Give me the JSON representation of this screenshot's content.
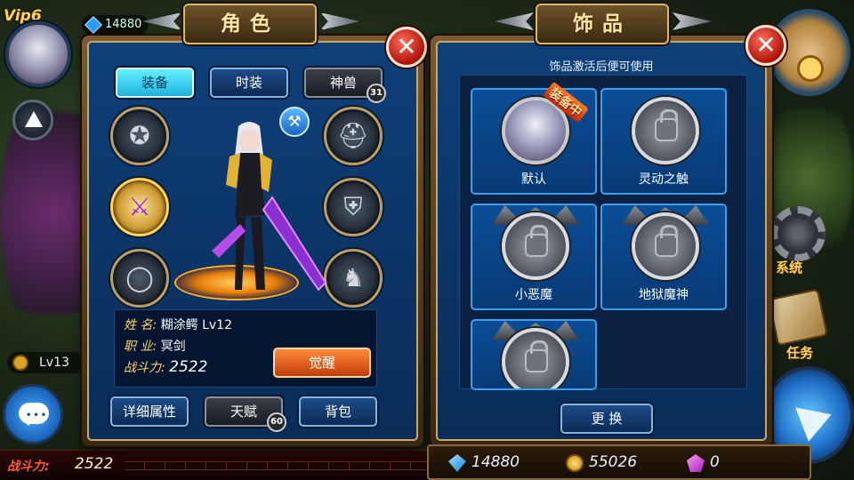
{
  "hud": {
    "vip": "Vip6",
    "top_gems": "14880",
    "level_text": "Lv13",
    "combat_label": "战斗力:",
    "combat_value": "2522",
    "side_system": "系统",
    "side_task": "任务"
  },
  "role_panel": {
    "title": "角色",
    "tabs": [
      {
        "label": "装备",
        "active": true
      },
      {
        "label": "时装",
        "active": false
      },
      {
        "label": "神兽",
        "active": false,
        "lock_level": "31"
      }
    ],
    "equip_slots": [
      {
        "name": "necklace",
        "icon": "pentagram-necklace-icon"
      },
      {
        "name": "helmet",
        "icon": "helmet-icon"
      },
      {
        "name": "weapon",
        "icon": "purple-sword-icon"
      },
      {
        "name": "armor",
        "icon": "armor-icon"
      },
      {
        "name": "ring",
        "icon": "ring-icon"
      },
      {
        "name": "boots",
        "icon": "boots-icon"
      }
    ],
    "info": {
      "name_label": "姓  名:",
      "name_value": "糊涂鳄",
      "level": "Lv12",
      "class_label": "职  业:",
      "class_value": "冥剑",
      "power_label": "战斗力:",
      "power_value": "2522"
    },
    "awaken_button": "觉醒",
    "bottom_buttons": {
      "details": "详细属性",
      "talent": "天赋",
      "talent_lock": "60",
      "bag": "背包"
    }
  },
  "accessory_panel": {
    "title": "饰品",
    "notice": "饰品激活后便可使用",
    "equipped_tag": "装备中",
    "items": [
      {
        "label": "默认",
        "equipped": true,
        "locked": false
      },
      {
        "label": "灵动之触",
        "equipped": false,
        "locked": true
      },
      {
        "label": "小恶魔",
        "equipped": false,
        "locked": true
      },
      {
        "label": "地狱魔神",
        "equipped": false,
        "locked": true
      },
      {
        "label": "",
        "equipped": false,
        "locked": true
      }
    ],
    "replace_button": "更 换"
  },
  "currency": {
    "diamonds": "14880",
    "gold": "55026",
    "gems": "0"
  },
  "colors": {
    "panel_blue": "#0e3f78",
    "frame_gold": "#c9a864",
    "active_tab": "#64f0ff",
    "awaken_orange": "#ff8a3a",
    "close_red": "#b01208"
  }
}
